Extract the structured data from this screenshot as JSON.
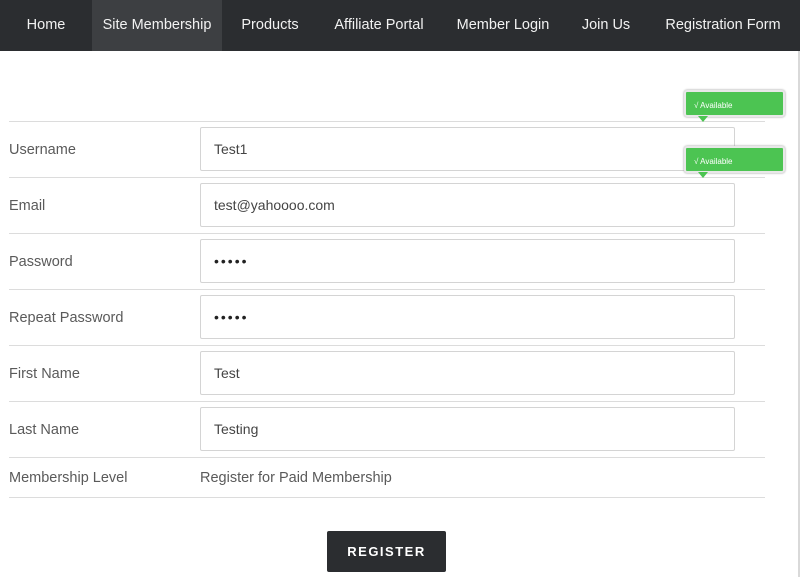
{
  "nav": {
    "items": [
      {
        "label": "Home"
      },
      {
        "label": "Site Membership"
      },
      {
        "label": "Products"
      },
      {
        "label": "Affiliate Portal"
      },
      {
        "label": "Member Login"
      },
      {
        "label": "Join Us"
      },
      {
        "label": "Registration Form"
      }
    ],
    "active_index": 1
  },
  "tooltips": {
    "username": {
      "text": "√ Available",
      "color": "#4cc452"
    },
    "email": {
      "text": "√ Available",
      "color": "#4cc452"
    }
  },
  "form": {
    "username": {
      "label": "Username",
      "value": "Test1"
    },
    "email": {
      "label": "Email",
      "value": "test@yahoooo.com"
    },
    "password": {
      "label": "Password",
      "value": "•••••"
    },
    "repeat_password": {
      "label": "Repeat Password",
      "value": "•••••"
    },
    "first_name": {
      "label": "First Name",
      "value": "Test"
    },
    "last_name": {
      "label": "Last Name",
      "value": "Testing"
    },
    "membership_level": {
      "label": "Membership Level",
      "value": "Register for Paid Membership"
    }
  },
  "register_button": {
    "label": "REGISTER"
  }
}
